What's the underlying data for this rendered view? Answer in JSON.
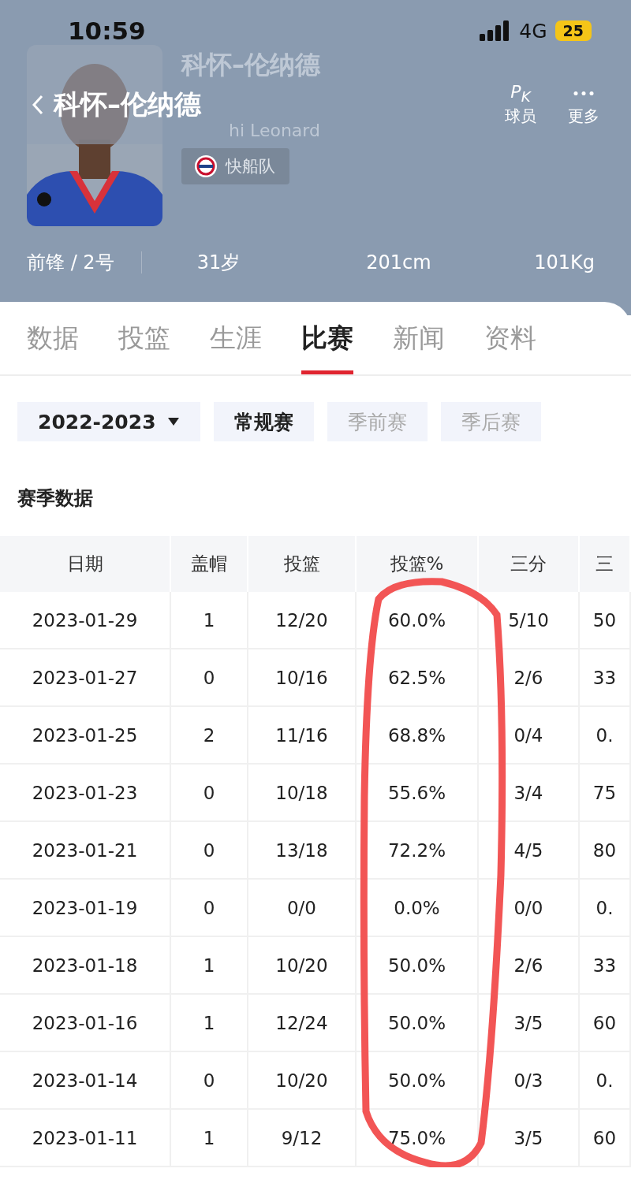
{
  "status_bar": {
    "time": "10:59",
    "network": "4G",
    "battery": "25"
  },
  "nav": {
    "title": "科怀–伦纳德",
    "actions": [
      {
        "kind": "pk",
        "icon_text": "P$_{K}$",
        "label": "球员"
      },
      {
        "kind": "more",
        "label": "更多"
      }
    ]
  },
  "player": {
    "name": "科怀–伦纳德",
    "english_name": "hi Leonard",
    "team": "快船队",
    "position": "前锋 / 2号",
    "age": "31岁",
    "height": "201cm",
    "weight": "101Kg"
  },
  "tabs": [
    {
      "label": "数据",
      "selected": false
    },
    {
      "label": "投篮",
      "selected": false
    },
    {
      "label": "生涯",
      "selected": false
    },
    {
      "label": "比赛",
      "selected": true
    },
    {
      "label": "新闻",
      "selected": false
    },
    {
      "label": "资料",
      "selected": false
    }
  ],
  "season_select": {
    "value": "2022-2023"
  },
  "game_types": [
    {
      "label": "常规赛",
      "selected": true
    },
    {
      "label": "季前赛",
      "selected": false
    },
    {
      "label": "季后赛",
      "selected": false
    }
  ],
  "section_title": "赛季数据",
  "table": {
    "columns": [
      "日期",
      "盖帽",
      "投篮",
      "投篮%",
      "三分",
      "三"
    ],
    "rows": [
      [
        "2023-01-29",
        "1",
        "12/20",
        "60.0%",
        "5/10",
        "50"
      ],
      [
        "2023-01-27",
        "0",
        "10/16",
        "62.5%",
        "2/6",
        "33"
      ],
      [
        "2023-01-25",
        "2",
        "11/16",
        "68.8%",
        "0/4",
        "0."
      ],
      [
        "2023-01-23",
        "0",
        "10/18",
        "55.6%",
        "3/4",
        "75"
      ],
      [
        "2023-01-21",
        "0",
        "13/18",
        "72.2%",
        "4/5",
        "80"
      ],
      [
        "2023-01-19",
        "0",
        "0/0",
        "0.0%",
        "0/0",
        "0."
      ],
      [
        "2023-01-18",
        "1",
        "10/20",
        "50.0%",
        "2/6",
        "33"
      ],
      [
        "2023-01-16",
        "1",
        "12/24",
        "50.0%",
        "3/5",
        "60"
      ],
      [
        "2023-01-14",
        "0",
        "10/20",
        "50.0%",
        "0/3",
        "0."
      ],
      [
        "2023-01-11",
        "1",
        "9/12",
        "75.0%",
        "3/5",
        "60"
      ]
    ]
  },
  "annotation": {
    "kind": "circled_column",
    "color": "#f25555"
  }
}
